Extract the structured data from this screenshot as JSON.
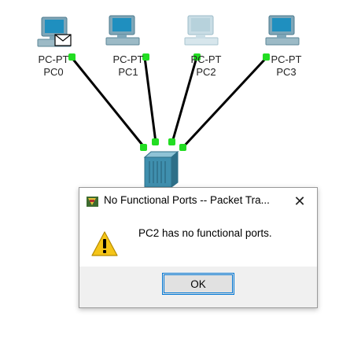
{
  "topology": {
    "devices": [
      {
        "type_label": "PC-PT",
        "name": "PC0"
      },
      {
        "type_label": "PC-PT",
        "name": "PC1"
      },
      {
        "type_label": "PC-PT",
        "name": "PC2"
      },
      {
        "type_label": "PC-PT",
        "name": "PC3"
      }
    ],
    "colors": {
      "link": "#000000",
      "link_up": "#22dd22",
      "pc_screen": "#1f8fbf",
      "pc_body": "#7ea6b8",
      "pc_faded": "#b7d2dc",
      "switch": "#3f8fae"
    }
  },
  "dialog": {
    "title": "No Functional Ports -- Packet Tra...",
    "close_icon": "close-icon",
    "warning_icon": "warning-icon",
    "message": "PC2 has no functional ports.",
    "ok_label": "OK"
  }
}
